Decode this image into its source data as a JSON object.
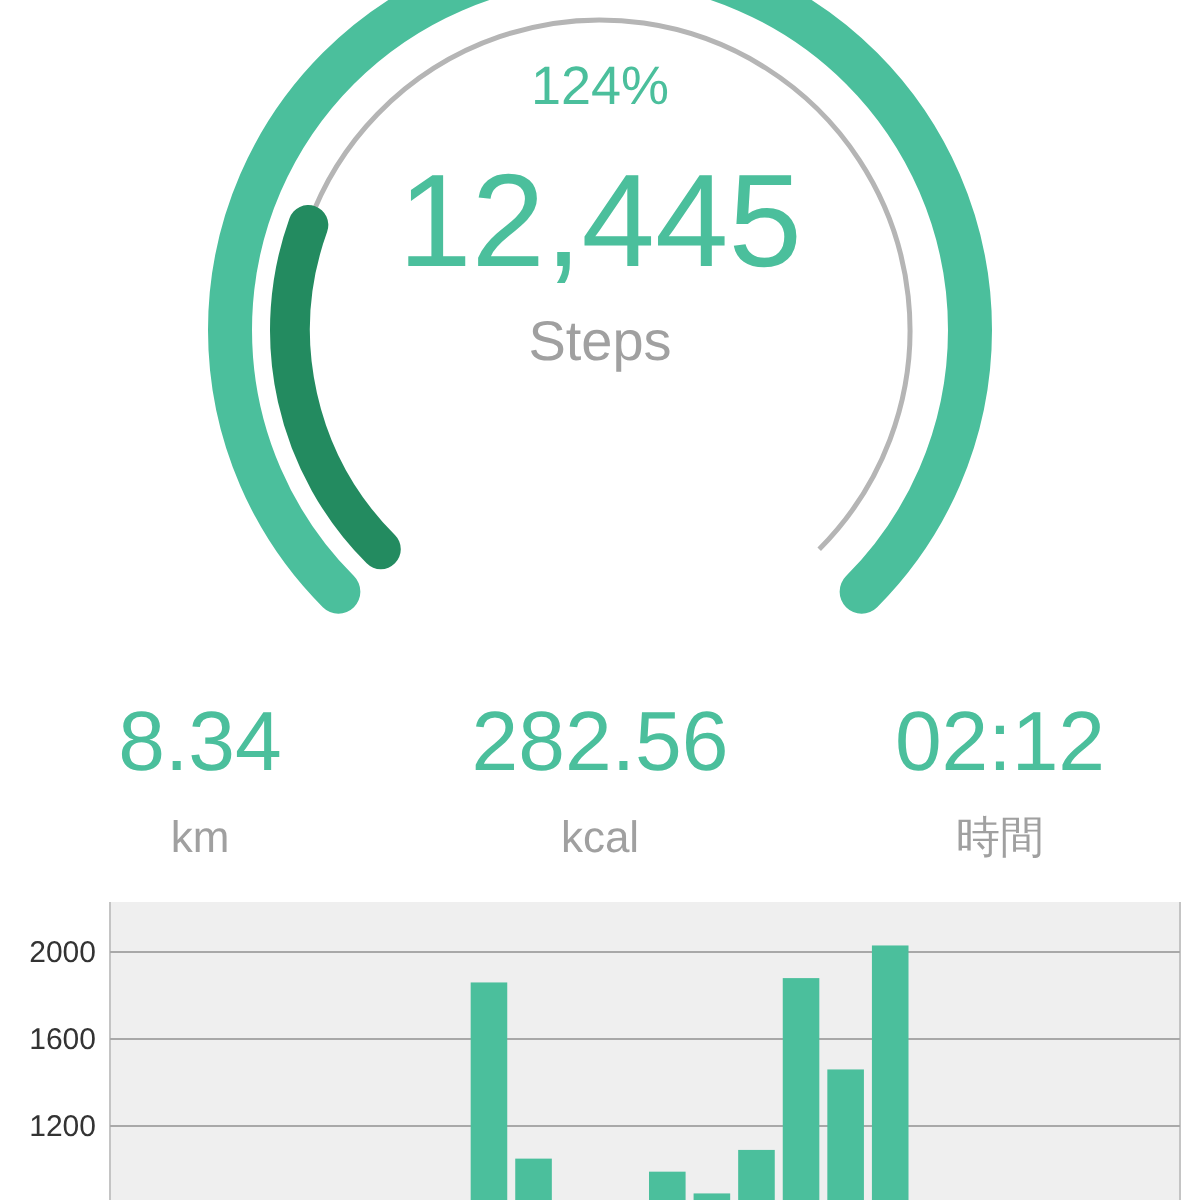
{
  "gauge": {
    "percent": "124%",
    "steps": "12,445",
    "unit": "Steps",
    "overflow_ring": {
      "level": 0.24
    }
  },
  "stats": [
    {
      "value": "8.34",
      "unit": "km"
    },
    {
      "value": "282.56",
      "unit": "kcal"
    },
    {
      "value": "02:12",
      "unit": "時間"
    }
  ],
  "chart": {
    "chart_data": {
      "type": "bar",
      "grid": true,
      "yticks": [
        1200,
        1600,
        2000
      ],
      "ylim": [
        0,
        2230
      ],
      "series": [
        {
          "color": "#4bbf9c",
          "values": [
            0,
            0,
            0,
            0,
            0,
            0,
            0,
            0,
            1860,
            1050,
            null,
            null,
            990,
            890,
            1090,
            1880,
            1460,
            2030,
            0,
            0,
            0,
            0,
            0,
            0
          ]
        }
      ]
    }
  }
}
